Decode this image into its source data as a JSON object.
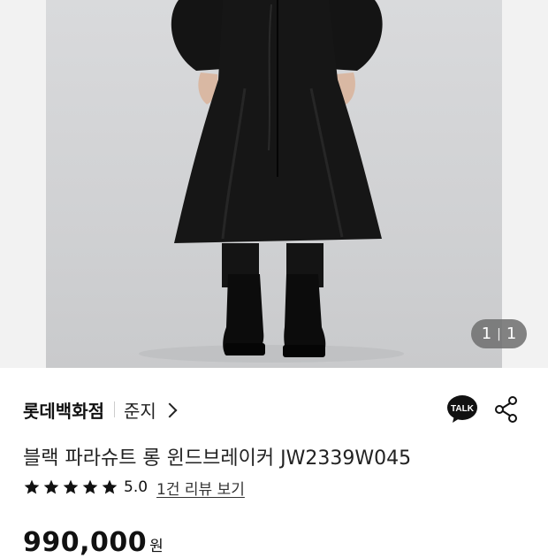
{
  "image_counter": {
    "current": "1",
    "separator": "|",
    "total": "1"
  },
  "seller": {
    "brand": "롯데백화점",
    "name": "준지"
  },
  "actions": {
    "talk_label": "TALK",
    "talk_icon": "kakao-talk-icon",
    "share_icon": "share-icon"
  },
  "product": {
    "title": "블랙 파라슈트 롱 윈드브레이커 JW2339W045",
    "rating": "5.0",
    "stars": 5,
    "review_link": "1건 리뷰 보기",
    "price": "990,000",
    "currency": "원"
  },
  "colors": {
    "star": "#111111",
    "talk_bubble": "#111111"
  }
}
